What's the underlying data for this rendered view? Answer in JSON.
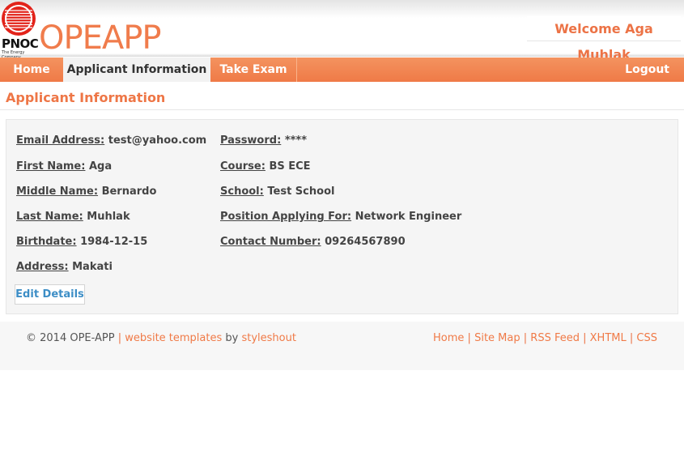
{
  "header": {
    "logo_text": "PNOC",
    "logo_subtext": "The Energy Company",
    "app_title": "OPEAPP",
    "welcome": "Welcome Aga Muhlak"
  },
  "nav": {
    "home": "Home",
    "applicant_info": "Applicant Information",
    "take_exam": "Take Exam",
    "logout": "Logout"
  },
  "page": {
    "title": "Applicant Information"
  },
  "applicant": {
    "email": {
      "label": "Email Address:",
      "value": "test@yahoo.com"
    },
    "first_name": {
      "label": "First Name:",
      "value": "Aga"
    },
    "middle_name": {
      "label": "Middle Name:",
      "value": "Bernardo"
    },
    "last_name": {
      "label": "Last Name:",
      "value": "Muhlak"
    },
    "birthdate": {
      "label": "Birthdate:",
      "value": "1984-12-15"
    },
    "address": {
      "label": "Address:",
      "value": "Makati"
    },
    "password": {
      "label": "Password:",
      "value": "****"
    },
    "course": {
      "label": "Course:",
      "value": "BS ECE"
    },
    "school": {
      "label": "School:",
      "value": "Test School"
    },
    "position": {
      "label": "Position Applying For:",
      "value": "Network Engineer"
    },
    "contact": {
      "label": "Contact Number:",
      "value": "09264567890"
    }
  },
  "edit_button": "Edit Details",
  "footer": {
    "copyright": "© 2014 OPE-APP",
    "sep": "|",
    "templates_link": "website templates",
    "by": "by",
    "styleshout_link": "styleshout",
    "links": [
      "Home",
      "Site Map",
      "RSS Feed",
      "XHTML",
      "CSS"
    ]
  },
  "colors": {
    "accent": "#f07c4c",
    "link": "#3d8ec6"
  }
}
